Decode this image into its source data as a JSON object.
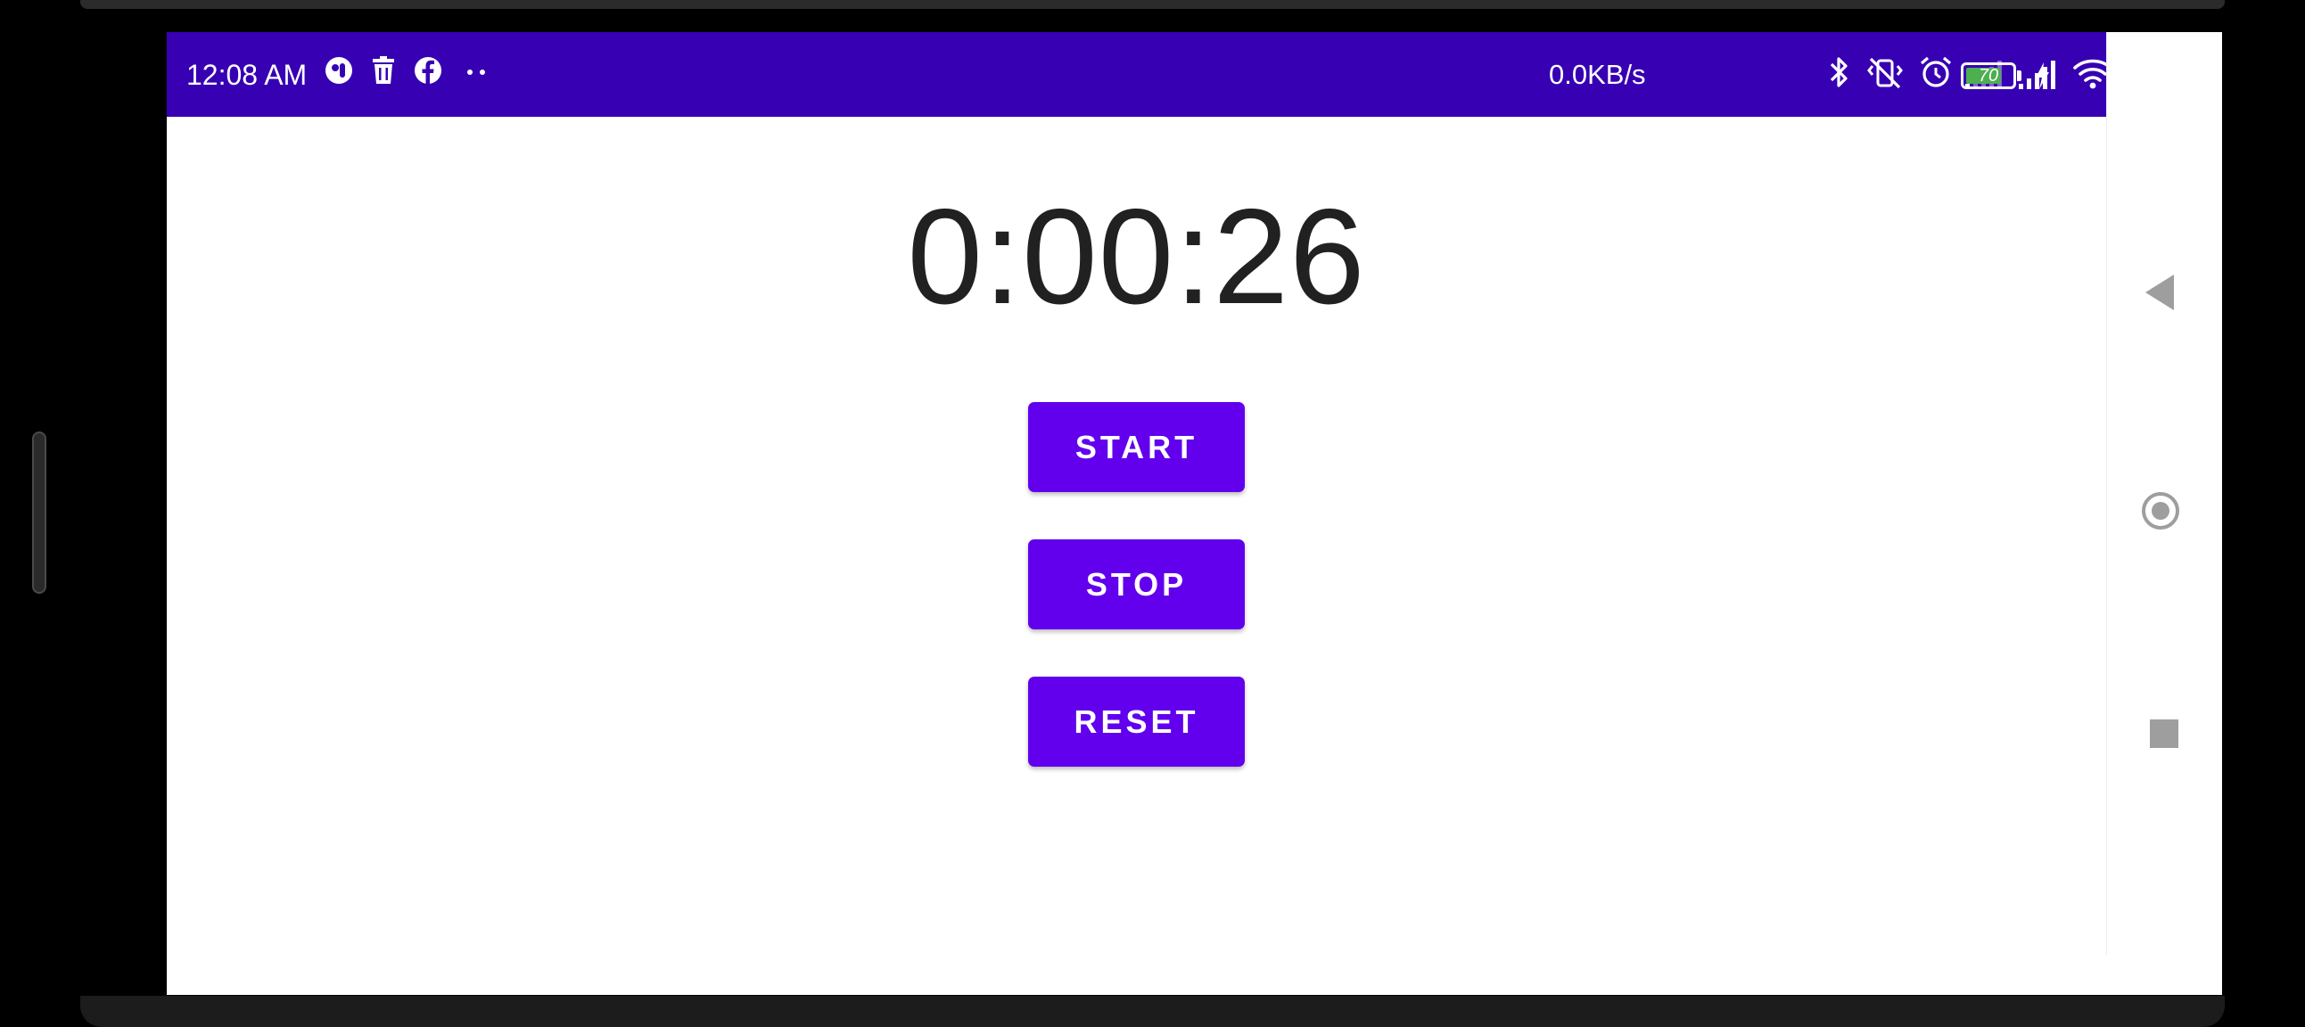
{
  "status_bar": {
    "time": "12:08 AM",
    "network_speed": "0.0KB/s",
    "battery_level": "70",
    "left_icons": [
      "messenger-icon",
      "trash-icon",
      "facebook-icon",
      "more-dots-icon"
    ],
    "right_icons": [
      "bluetooth-icon",
      "vibrate-off-icon",
      "alarm-icon",
      "signal-weak-icon",
      "signal-strong-icon",
      "wifi-icon",
      "battery-icon",
      "charging-icon"
    ],
    "colors": {
      "background": "#3700b3",
      "text": "#ffffff",
      "battery_fill": "#4caf50"
    }
  },
  "stopwatch": {
    "time": "0:00:26"
  },
  "buttons": {
    "start_label": "START",
    "stop_label": "STOP",
    "reset_label": "RESET"
  },
  "colors": {
    "button": "#6200ee",
    "timer_text": "#212121",
    "background": "#ffffff",
    "nav_icons": "#9e9e9e"
  },
  "navigation": {
    "buttons": [
      "back-icon",
      "home-icon",
      "recents-icon"
    ]
  }
}
